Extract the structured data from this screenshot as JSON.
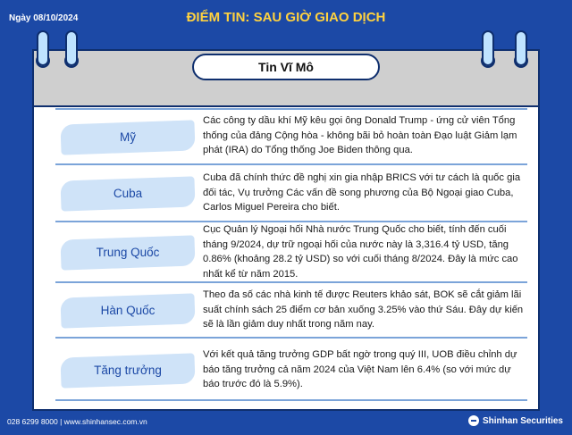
{
  "header": {
    "date": "Ngày 08/10/2024",
    "title": "ĐIỂM TIN: SAU GIỜ GIAO DỊCH"
  },
  "section": {
    "title": "Tin Vĩ Mô"
  },
  "rows": [
    {
      "label": "Mỹ",
      "text": "Các công ty dầu khí Mỹ kêu gọi ông Donald Trump - ứng cử viên Tổng thống của đảng Cộng hòa - không bãi bỏ hoàn toàn Đạo luật Giảm lạm phát (IRA) do Tổng thống Joe Biden thông qua."
    },
    {
      "label": "Cuba",
      "text": "Cuba đã chính thức đề nghị xin gia nhập BRICS với tư cách là quốc gia đối tác, Vụ trưởng Các vấn đề song phương của Bộ Ngoại giao Cuba, Carlos Miguel Pereira cho biết."
    },
    {
      "label": "Trung Quốc",
      "text": "Cục Quản lý Ngoại hối Nhà nước Trung Quốc cho biết, tính đến cuối tháng 9/2024, dự trữ ngoại hối của nước này là 3,316.4 tỷ USD, tăng 0.86% (khoảng 28.2 tỷ USD) so với cuối tháng 8/2024. Đây là mức cao nhất kể từ năm 2015."
    },
    {
      "label": "Hàn Quốc",
      "text": "Theo đa số các nhà kinh tế được Reuters khảo sát, BOK sẽ cắt giảm lãi suất chính sách 25 điểm cơ bản xuống 3.25% vào thứ Sáu. Đây dự kiến sẽ là lần giảm duy nhất trong năm nay."
    },
    {
      "label": "Tăng trưởng",
      "text": "Với kết quả tăng trưởng GDP bất ngờ trong quý III, UOB điều chỉnh dự báo tăng trưởng cả năm 2024 của Việt Nam lên 6.4% (so với mức dự báo trước đó là 5.9%)."
    }
  ],
  "footer": {
    "contact": "028 6299 8000  |  www.shinhansec.com.vn",
    "brand": "Shinhan Securities"
  },
  "colors": {
    "background": "#1c49a6",
    "title": "#ffd23f",
    "label_fill": "#cfe3f8",
    "divider": "#7ba4d9"
  }
}
